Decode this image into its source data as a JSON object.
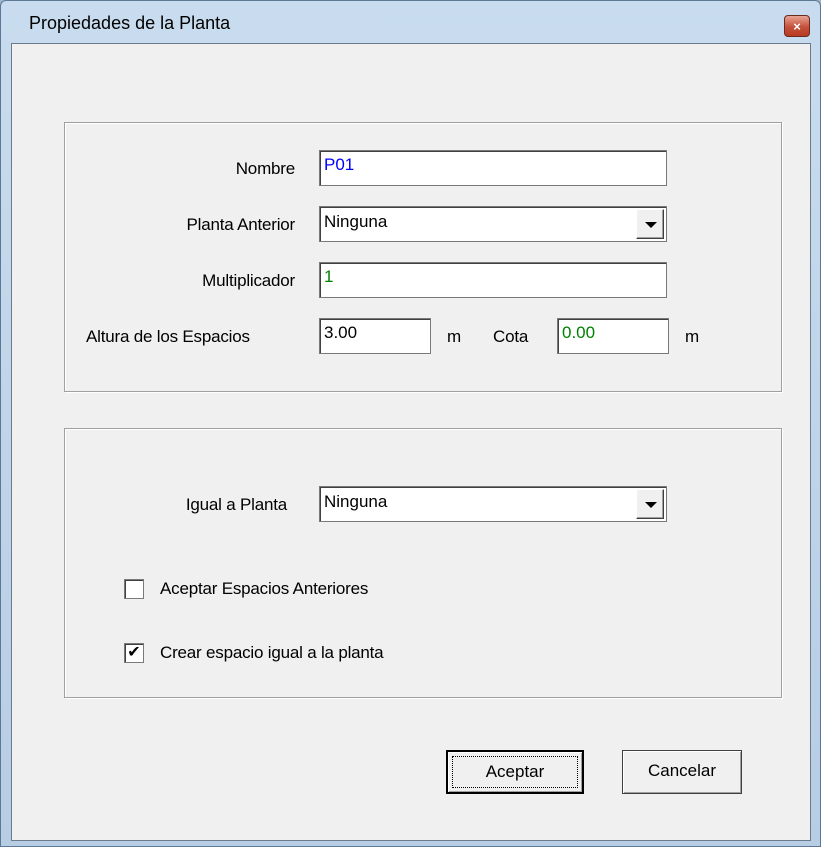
{
  "window": {
    "title": "Propiedades de la Planta",
    "close_glyph": "×"
  },
  "fields": {
    "nombre": {
      "label": "Nombre",
      "value": "P01"
    },
    "planta_anterior": {
      "label": "Planta Anterior",
      "value": "Ninguna"
    },
    "multiplicador": {
      "label": "Multiplicador",
      "value": "1"
    },
    "altura": {
      "label": "Altura de los Espacios",
      "value": "3.00",
      "unit": "m"
    },
    "cota": {
      "label": "Cota",
      "value": "0.00",
      "unit": "m"
    }
  },
  "group2": {
    "igual_a_planta": {
      "label": "Igual a Planta",
      "value": "Ninguna"
    },
    "aceptar_espacios": {
      "label": "Aceptar Espacios Anteriores",
      "checked": false,
      "mark": ""
    },
    "crear_espacio": {
      "label": "Crear espacio igual a la planta",
      "checked": true,
      "mark": "✔"
    }
  },
  "buttons": {
    "ok": "Aceptar",
    "cancel": "Cancelar"
  },
  "colors": {
    "value_blue": "#0000ff",
    "value_green": "#008000",
    "dialog_bg": "#f0f0f0"
  }
}
